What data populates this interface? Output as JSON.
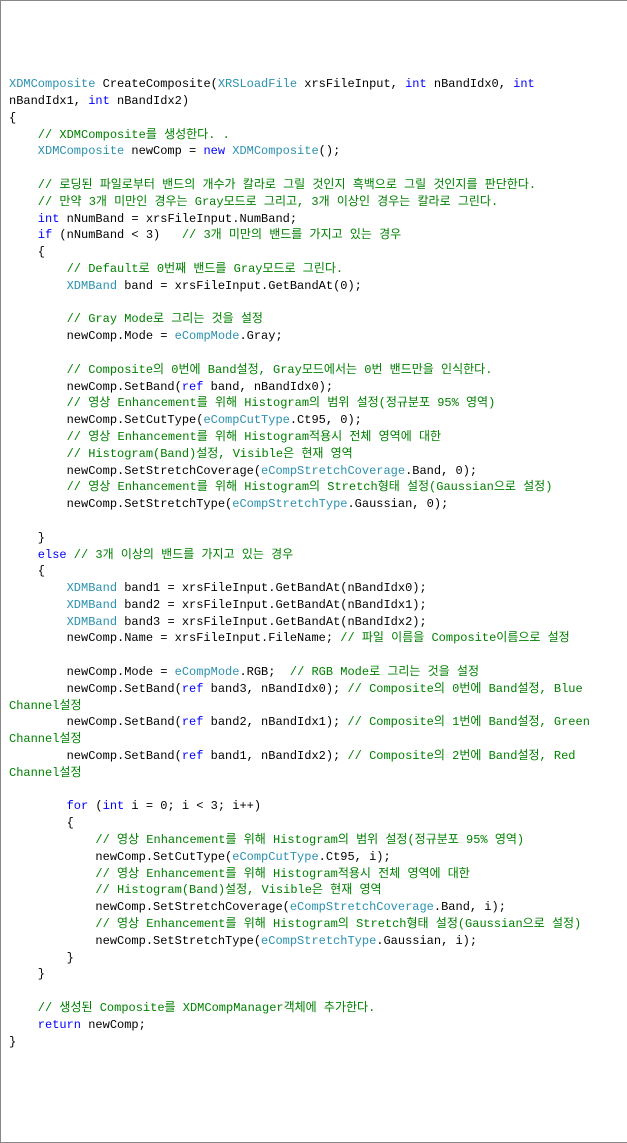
{
  "code": {
    "l1_type1": "XDMComposite",
    "l1_method": " CreateComposite(",
    "l1_type2": "XRSLoadFile",
    "l1_param1": " xrsFileInput, ",
    "l1_kw1": "int",
    "l1_param2": " nBandIdx0, ",
    "l1_kw2": "int",
    "l2_param": "nBandIdx1, ",
    "l2_kw": "int",
    "l2_param2": " nBandIdx2)",
    "l3": "{",
    "l4_cm": "    // XDMComposite를 생성한다. .",
    "l5_type": "    XDMComposite",
    "l5_var": " newComp = ",
    "l5_kw": "new",
    "l5_type2": " XDMComposite",
    "l5_end": "();",
    "l7_cm": "    // 로딩된 파일로부터 밴드의 개수가 칼라로 그릴 것인지 흑백으로 그릴 것인지를 판단한다.",
    "l8_cm": "    // 만약 3개 미만인 경우는 Gray모드로 그리고, 3개 이상인 경우는 칼라로 그린다.",
    "l9_kw": "    int",
    "l9_rest": " nNumBand = xrsFileInput.NumBand;",
    "l10_kw": "    if",
    "l10_rest": " (nNumBand < 3)   ",
    "l10_cm": "// 3개 미만의 밴드를 가지고 있는 경우",
    "l11": "    {",
    "l12_cm": "        // Default로 0번째 밴드를 Gray모드로 그린다.",
    "l13_type": "        XDMBand",
    "l13_rest": " band = xrsFileInput.GetBandAt(0);",
    "l15_cm": "        // Gray Mode로 그리는 것을 설정",
    "l16_pre": "        newComp.Mode = ",
    "l16_enum": "eCompMode",
    "l16_rest": ".Gray;",
    "l18_cm": "        // Composite의 0번에 Band설정, Gray모드에서는 0번 밴드만을 인식한다.",
    "l19_pre": "        newComp.SetBand(",
    "l19_kw": "ref",
    "l19_rest": " band, nBandIdx0);",
    "l20_cm": "        // 영상 Enhancement를 위해 Histogram의 범위 설정(정규분포 95% 영역)",
    "l21_pre": "        newComp.SetCutType(",
    "l21_enum": "eCompCutType",
    "l21_rest": ".Ct95, 0);",
    "l22_cm": "        // 영상 Enhancement를 위해 Histogram적용시 전체 영역에 대한",
    "l23_cm": "        // Histogram(Band)설정, Visible은 현재 영역",
    "l24_pre": "        newComp.SetStretchCoverage(",
    "l24_enum": "eCompStretchCoverage",
    "l24_rest": ".Band, 0);",
    "l25_cm": "        // 영상 Enhancement를 위해 Histogram의 Stretch형태 설정(Gaussian으로 설정)",
    "l26_pre": "        newComp.SetStretchType(",
    "l26_enum": "eCompStretchType",
    "l26_rest": ".Gaussian, 0);",
    "l28": "    }",
    "l29_kw": "    else",
    "l29_cm": " // 3개 이상의 밴드를 가지고 있는 경우",
    "l30": "    {",
    "l31_type": "        XDMBand",
    "l31_rest": " band1 = xrsFileInput.GetBandAt(nBandIdx0);",
    "l32_type": "        XDMBand",
    "l32_rest": " band2 = xrsFileInput.GetBandAt(nBandIdx1);",
    "l33_type": "        XDMBand",
    "l33_rest": " band3 = xrsFileInput.GetBandAt(nBandIdx2);",
    "l34_pre": "        newComp.Name = xrsFileInput.FileName; ",
    "l34_cm": "// 파일 이름을 Composite이름으로 설정",
    "l36_pre": "        newComp.Mode = ",
    "l36_enum": "eCompMode",
    "l36_mid": ".RGB;  ",
    "l36_cm": "// RGB Mode로 그리는 것을 설정",
    "l37_pre": "        newComp.SetBand(",
    "l37_kw": "ref",
    "l37_mid": " band3, nBandIdx0); ",
    "l37_cm": "// Composite의 0번에 Band설정, Blue ",
    "l38_cm": "Channel설정",
    "l39_pre": "        newComp.SetBand(",
    "l39_kw": "ref",
    "l39_mid": " band2, nBandIdx1); ",
    "l39_cm": "// Composite의 1번에 Band설정, Green ",
    "l40_cm": "Channel설정",
    "l41_pre": "        newComp.SetBand(",
    "l41_kw": "ref",
    "l41_mid": " band1, nBandIdx2); ",
    "l41_cm": "// Composite의 2번에 Band설정, Red ",
    "l42_cm": "Channel설정",
    "l44_kw": "        for",
    "l44_mid": " (",
    "l44_kw2": "int",
    "l44_rest": " i = 0; i < 3; i++)",
    "l45": "        {",
    "l46_cm": "            // 영상 Enhancement를 위해 Histogram의 범위 설정(정규분포 95% 영역)",
    "l47_pre": "            newComp.SetCutType(",
    "l47_enum": "eCompCutType",
    "l47_rest": ".Ct95, i);",
    "l48_cm": "            // 영상 Enhancement를 위해 Histogram적용시 전체 영역에 대한",
    "l49_cm": "            // Histogram(Band)설정, Visible은 현재 영역",
    "l50_pre": "            newComp.SetStretchCoverage(",
    "l50_enum": "eCompStretchCoverage",
    "l50_rest": ".Band, i);",
    "l51_cm": "            // 영상 Enhancement를 위해 Histogram의 Stretch형태 설정(Gaussian으로 설정)",
    "l52_pre": "            newComp.SetStretchType(",
    "l52_enum": "eCompStretchType",
    "l52_rest": ".Gaussian, i);",
    "l53": "        }",
    "l54": "    }",
    "l56_cm": "    // 생성된 Composite를 XDMCompManager객체에 추가한다.",
    "l57_kw": "    return",
    "l57_rest": " newComp;",
    "l58": "}"
  }
}
